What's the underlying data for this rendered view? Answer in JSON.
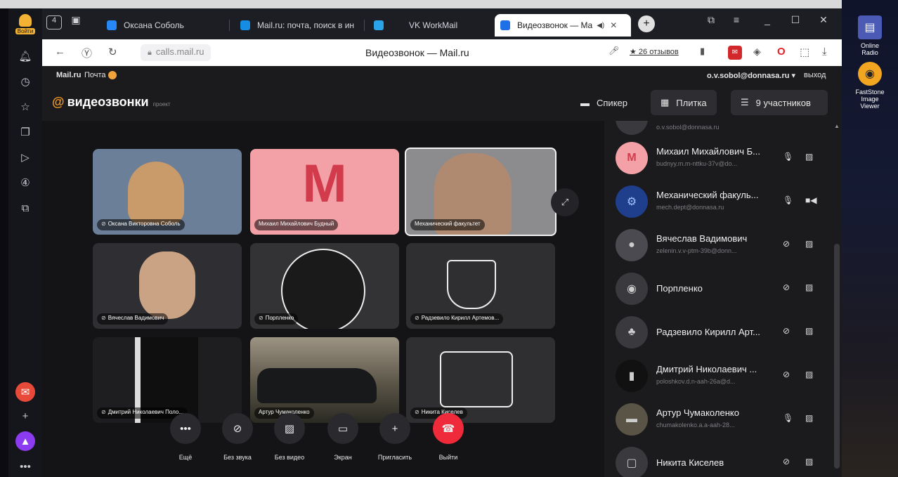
{
  "browser": {
    "login_label": "Войти",
    "tabs": [
      {
        "title": "Оксана Соболь",
        "color": "#2787f5"
      },
      {
        "title": "Mail.ru: почта, поиск в ин",
        "color": "#168de2"
      },
      {
        "title": "VK WorkMail",
        "color": "#2aa3e8"
      },
      {
        "title": "Видеозвонок — Ma",
        "color": "#1f6fe6",
        "active": true
      }
    ],
    "tab_count_badge": "4",
    "url": "calls.mail.ru",
    "page_title": "Видеозвонок — Mail.ru",
    "reviews": "★ 26 отзывов"
  },
  "mailbar": {
    "brand": "Mail.ru",
    "mail": "Почта",
    "user": "o.v.sobol@donnasa.ru ▾",
    "exit": "выход"
  },
  "header": {
    "logo": "видеозвонки",
    "project": "проект",
    "speaker": "Спикер",
    "tile": "Плитка",
    "participants": "9 участников"
  },
  "tiles": [
    {
      "name": "Оксана Викторовна Соболь",
      "bg": "#6c7f98"
    },
    {
      "name": "Михаил Михайлович Будный",
      "bg": "#f3a1a6",
      "letter": "М"
    },
    {
      "name": "Механический факультет",
      "bg": "#8c8c8e",
      "active": true
    },
    {
      "name": "Вячеслав Вадимович",
      "bg": "#2f2f33"
    },
    {
      "name": "Порпленко",
      "bg": "#333336"
    },
    {
      "name": "Радзевило Кирилл Артемов...",
      "bg": "#2f2f31"
    },
    {
      "name": "Дмитрий Николаевич Поло...",
      "bg": "#1e1e20"
    },
    {
      "name": "Артур Чумаколенко",
      "bg": "#5a5447"
    },
    {
      "name": "Никита Киселев",
      "bg": "#2f2f31"
    }
  ],
  "controls": [
    {
      "label": "Ещё",
      "icon": "•••"
    },
    {
      "label": "Без звука",
      "icon": "🎙"
    },
    {
      "label": "Без видео",
      "icon": "▨"
    },
    {
      "label": "Экран",
      "icon": "▭"
    },
    {
      "label": "Пригласить",
      "icon": "+"
    },
    {
      "label": "Выйти",
      "icon": "☎"
    }
  ],
  "participants": [
    {
      "name": "",
      "email": "o.v.sobol@donnasa.ru",
      "avatar": ""
    },
    {
      "name": "Михаил Михайлович Б...",
      "email": "budnyy.m.m-nttku-37v@do...",
      "avatar": "М"
    },
    {
      "name": "Механический факуль...",
      "email": "mech.dept@donnasa.ru",
      "avatar": "⚙"
    },
    {
      "name": "Вячеслав Вадимович",
      "email": "zelenin.v.v-ptm-39b@donn...",
      "avatar": "●"
    },
    {
      "name": "Порпленко",
      "email": "",
      "avatar": "◉"
    },
    {
      "name": "Радзевило Кирилл Арт...",
      "email": "",
      "avatar": "♣"
    },
    {
      "name": "Дмитрий Николаевич ...",
      "email": "poloshkov.d.n-aah-26a@d...",
      "avatar": "▮"
    },
    {
      "name": "Артур Чумаколенко",
      "email": "chumakolenko.a.a-aah-28...",
      "avatar": "▬"
    },
    {
      "name": "Никита Киселев",
      "email": "",
      "avatar": "▢"
    }
  ],
  "desktop": [
    {
      "label": "Online Radio"
    },
    {
      "label": "FastStone Image Viewer"
    }
  ],
  "colors": {
    "accent": "#f59a23",
    "hangup": "#ee2a3b"
  }
}
